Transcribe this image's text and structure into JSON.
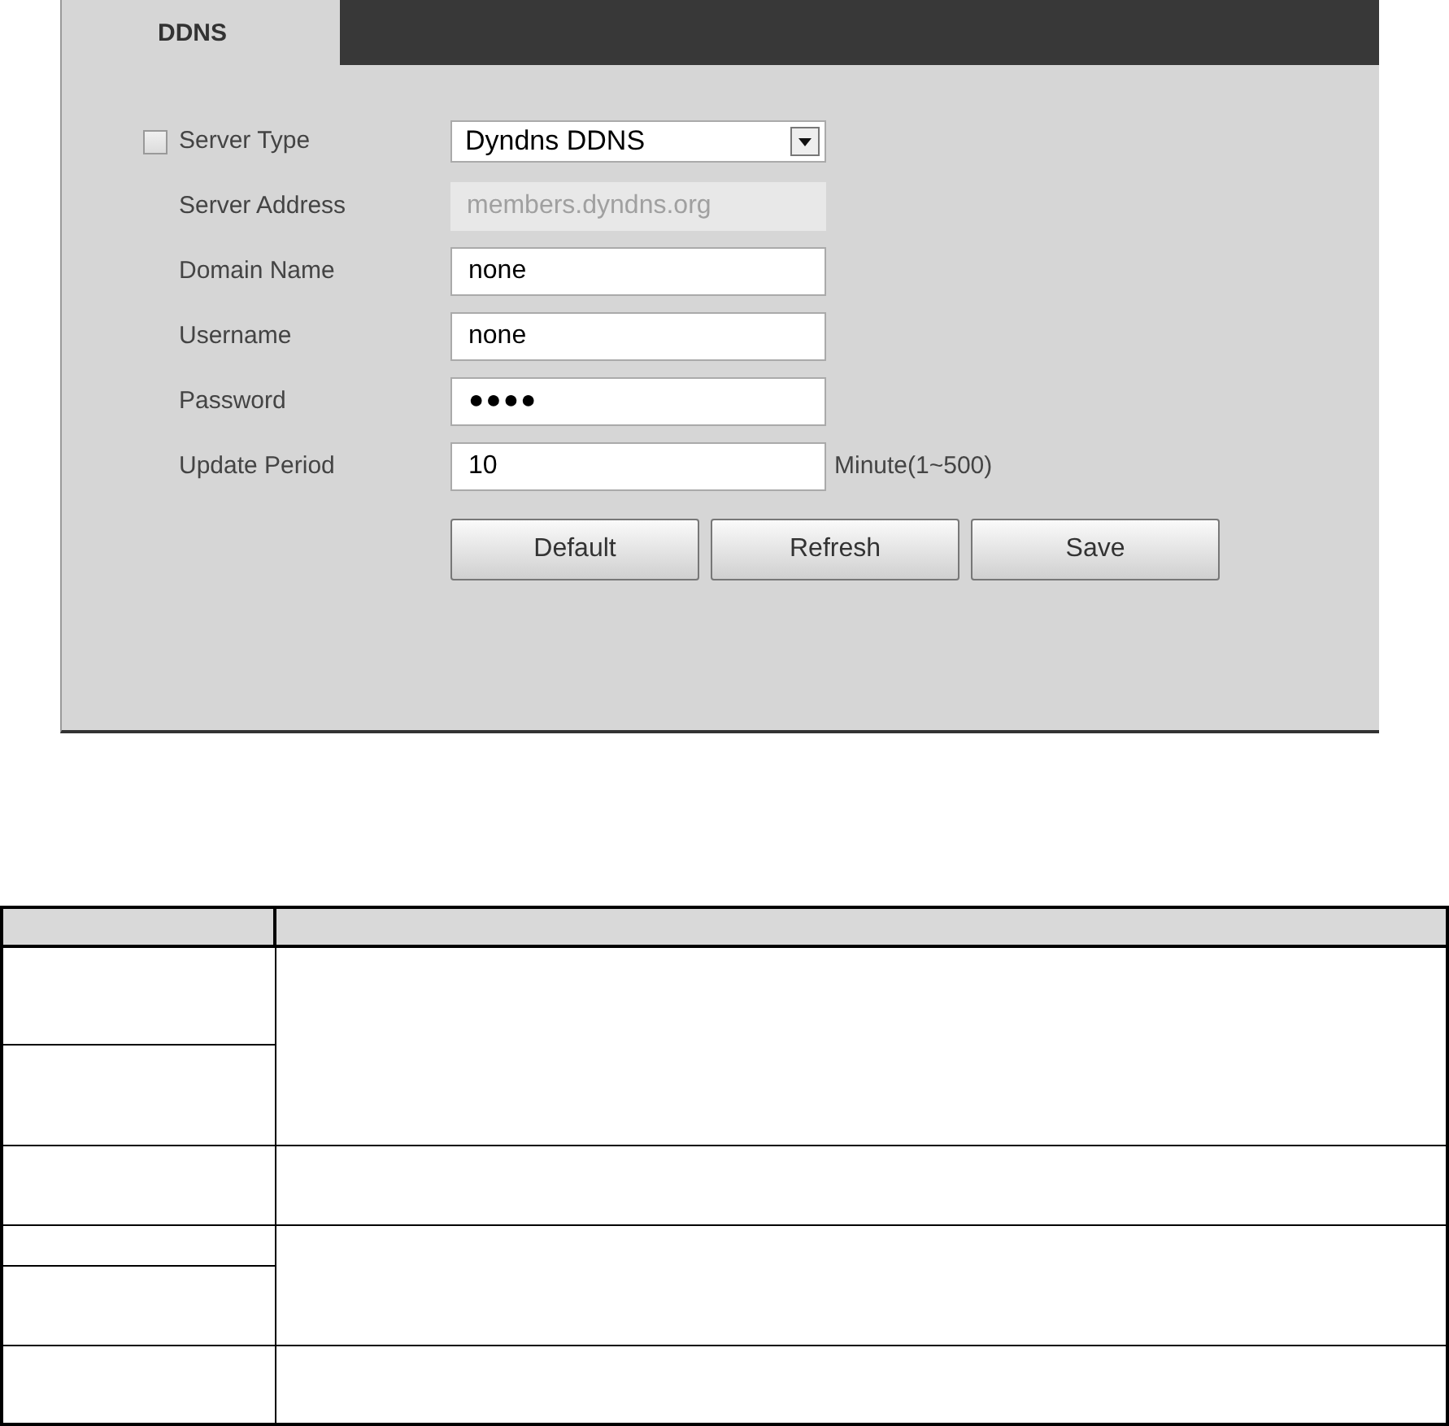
{
  "tabs": [
    {
      "label": "DDNS",
      "selected": true
    }
  ],
  "fields": [
    {
      "kind": "select",
      "label": "Server Type",
      "value": "Dyndns DDNS",
      "checkbox": {
        "checked": false
      }
    },
    {
      "kind": "disabled",
      "label": "Server Address",
      "value": "members.dyndns.org"
    },
    {
      "kind": "text",
      "label": "Domain Name",
      "value": "none"
    },
    {
      "kind": "text",
      "label": "Username",
      "value": "none"
    },
    {
      "kind": "password",
      "label": "Password",
      "value": "●●●●"
    },
    {
      "kind": "text",
      "label": "Update Period",
      "value": "10",
      "suffix": "Minute(1~500)"
    }
  ],
  "buttons": [
    "Default",
    "Refresh",
    "Save"
  ]
}
